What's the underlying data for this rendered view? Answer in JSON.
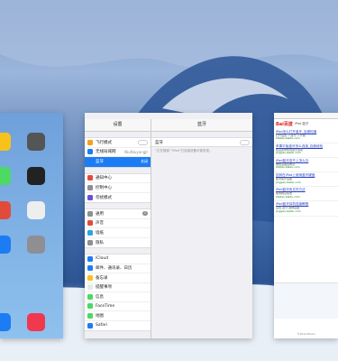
{
  "settings": {
    "sidebar_title": "设置",
    "detail_title": "蓝牙",
    "groups": [
      [
        {
          "label": "飞行模式",
          "color": "#f7a11b",
          "control": "toggle"
        },
        {
          "label": "无线局域网",
          "color": "#1c7cf4",
          "value": "NiuNiuyangjt"
        },
        {
          "label": "蓝牙",
          "color": "#1c7cf4",
          "value": "关闭",
          "selected": true
        }
      ],
      [
        {
          "label": "通知中心",
          "color": "#e14b3a"
        },
        {
          "label": "控制中心",
          "color": "#8e8e93"
        },
        {
          "label": "勿扰模式",
          "color": "#6a4fd6"
        }
      ],
      [
        {
          "label": "通用",
          "color": "#8e8e93",
          "badge": "1"
        },
        {
          "label": "声音",
          "color": "#e14b3a"
        },
        {
          "label": "墙纸",
          "color": "#2aa4e6"
        },
        {
          "label": "隐私",
          "color": "#8e8e93"
        }
      ],
      [
        {
          "label": "iCloud",
          "color": "#1c7cf4"
        },
        {
          "label": "邮件、通讯录、日历",
          "color": "#1c7cf4"
        },
        {
          "label": "备忘录",
          "color": "#f7c21b"
        },
        {
          "label": "提醒事项",
          "color": "#e8e8e8"
        },
        {
          "label": "信息",
          "color": "#4cd964"
        },
        {
          "label": "FaceTime",
          "color": "#4cd964"
        },
        {
          "label": "地图",
          "color": "#4cd964"
        },
        {
          "label": "Safari",
          "color": "#1c7cf4"
        }
      ]
    ],
    "detail_row_label": "蓝牙",
    "detail_note": "“正在搜索”“iPad”已连接设备可被发现。"
  },
  "browser": {
    "logo": "Bai百度",
    "query": "iPad 蓝牙",
    "results": [
      {
        "title": "iPad怎么打开蓝牙_百度知道",
        "desc": "打开设置 → 蓝牙 → 开启",
        "url": "zhidao.baidu.com"
      },
      {
        "title": "苹果平板蓝牙怎么连接_百度经验",
        "desc": "在设置中找到蓝牙选项",
        "url": "jingyan.baidu.com"
      },
      {
        "title": "iPad蓝牙连不上怎么办",
        "desc": "重启设备后再试",
        "url": "zhidao.baidu.com"
      },
      {
        "title": "如何在iPad上使用蓝牙键盘",
        "desc": "配对蓝牙设备",
        "url": "jingyan.baidu.com"
      },
      {
        "title": "iPad蓝牙传文件方法",
        "desc": "使用隔空投送",
        "url": "zhidao.baidu.com"
      },
      {
        "title": "iPad蓝牙耳机连接教程",
        "desc": "设置-蓝牙-选择设备",
        "url": "jingyan.baidu.com"
      }
    ],
    "footer": "©2014 Baidu"
  }
}
